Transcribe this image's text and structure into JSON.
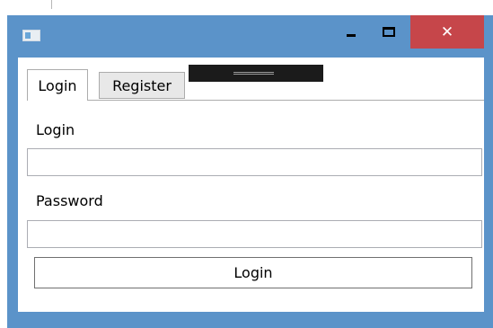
{
  "window": {
    "icon": "app-window-icon",
    "controls": {
      "minimize_icon": "minimize-icon",
      "maximize_icon": "maximize-icon",
      "close_icon": "close-icon",
      "close_glyph": "✕"
    },
    "title_color": "#5b93c9",
    "close_color": "#c6464a"
  },
  "tabs": [
    {
      "label": "Login",
      "selected": true
    },
    {
      "label": "Register",
      "selected": false
    }
  ],
  "form": {
    "login_label": "Login",
    "login_value": "",
    "password_label": "Password",
    "password_value": "",
    "submit_label": "Login"
  }
}
